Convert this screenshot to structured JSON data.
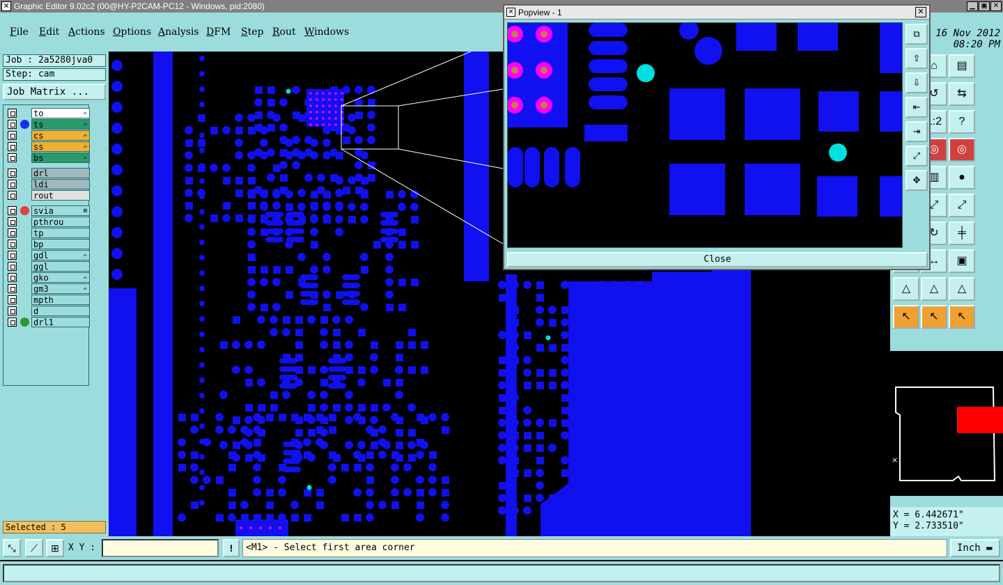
{
  "window": {
    "title": "Graphic Editor 9.02c2 (00@HY-P2CAM-PC12 - Windows, pid:2080)"
  },
  "menu": [
    {
      "label": "File",
      "u": "F",
      "rest": "ile"
    },
    {
      "label": "Edit",
      "u": "E",
      "rest": "dit"
    },
    {
      "label": "Actions",
      "u": "A",
      "rest": "ctions"
    },
    {
      "label": "Options",
      "u": "O",
      "rest": "ptions"
    },
    {
      "label": "Analysis",
      "u": "A",
      "rest": "nalysis"
    },
    {
      "label": "DFM",
      "u": "D",
      "rest": "FM"
    },
    {
      "label": "Step",
      "u": "S",
      "rest": "tep"
    },
    {
      "label": "Rout",
      "u": "R",
      "rest": "out"
    },
    {
      "label": "Windows",
      "u": "W",
      "rest": "indows"
    }
  ],
  "clock": {
    "date": "16 Nov 2012",
    "time": "08:20 PM"
  },
  "job": {
    "job_line": "Job : 2a5280jva0",
    "step_line": "Step: cam",
    "matrix_button": "Job Matrix ..."
  },
  "layers": [
    {
      "name": "to",
      "color": "#ffffff",
      "marker": "",
      "edit": "✍"
    },
    {
      "name": "ts",
      "color": "#2a9a6a",
      "marker": "#1030f0",
      "edit": "✍"
    },
    {
      "name": "cs",
      "color": "#f0b030",
      "marker": "",
      "edit": "✍"
    },
    {
      "name": "ss",
      "color": "#f0b030",
      "marker": "",
      "edit": "✍"
    },
    {
      "name": "bs",
      "color": "#2a9a6a",
      "marker": "",
      "edit": "✍"
    },
    {
      "name": "drl",
      "color": "#a0b8c0",
      "marker": "",
      "edit": ""
    },
    {
      "name": "ldi",
      "color": "#a0b8c0",
      "marker": "",
      "edit": ""
    },
    {
      "name": "rout",
      "color": "#e0e0e0",
      "marker": "",
      "edit": ""
    },
    {
      "name": "svia",
      "color": "#9ddcdc",
      "marker": "#e04040",
      "edit": "⊞"
    },
    {
      "name": "pthrou",
      "color": "#9ddcdc",
      "marker": "",
      "edit": ""
    },
    {
      "name": "tp",
      "color": "#9ddcdc",
      "marker": "",
      "edit": ""
    },
    {
      "name": "bp",
      "color": "#9ddcdc",
      "marker": "",
      "edit": ""
    },
    {
      "name": "gdl",
      "color": "#9ddcdc",
      "marker": "",
      "edit": "✍"
    },
    {
      "name": "ggl",
      "color": "#9ddcdc",
      "marker": "",
      "edit": ""
    },
    {
      "name": "gko",
      "color": "#9ddcdc",
      "marker": "",
      "edit": "✍"
    },
    {
      "name": "gm3",
      "color": "#9ddcdc",
      "marker": "",
      "edit": "✍"
    },
    {
      "name": "mpth",
      "color": "#9ddcdc",
      "marker": "",
      "edit": ""
    },
    {
      "name": "d",
      "color": "#9ddcdc",
      "marker": "",
      "edit": ""
    },
    {
      "name": "drl1",
      "color": "#9ddcdc",
      "marker": "#2a9a2a",
      "edit": ""
    }
  ],
  "selected": "Selected : 5",
  "popup": {
    "title": "Popview - 1",
    "close_label": "Close"
  },
  "coords": {
    "x": "X = 6.442671\"",
    "y": "Y = 2.733510\""
  },
  "bottom": {
    "xy_label": "X Y :",
    "xy_value": "",
    "prompt": "<M1> - Select first area corner",
    "units": "Inch"
  },
  "colors": {
    "copper": "#1010f0",
    "panel": "#9ddcdc",
    "accent": "#00e0e0",
    "highlight": "#ff00ff"
  }
}
